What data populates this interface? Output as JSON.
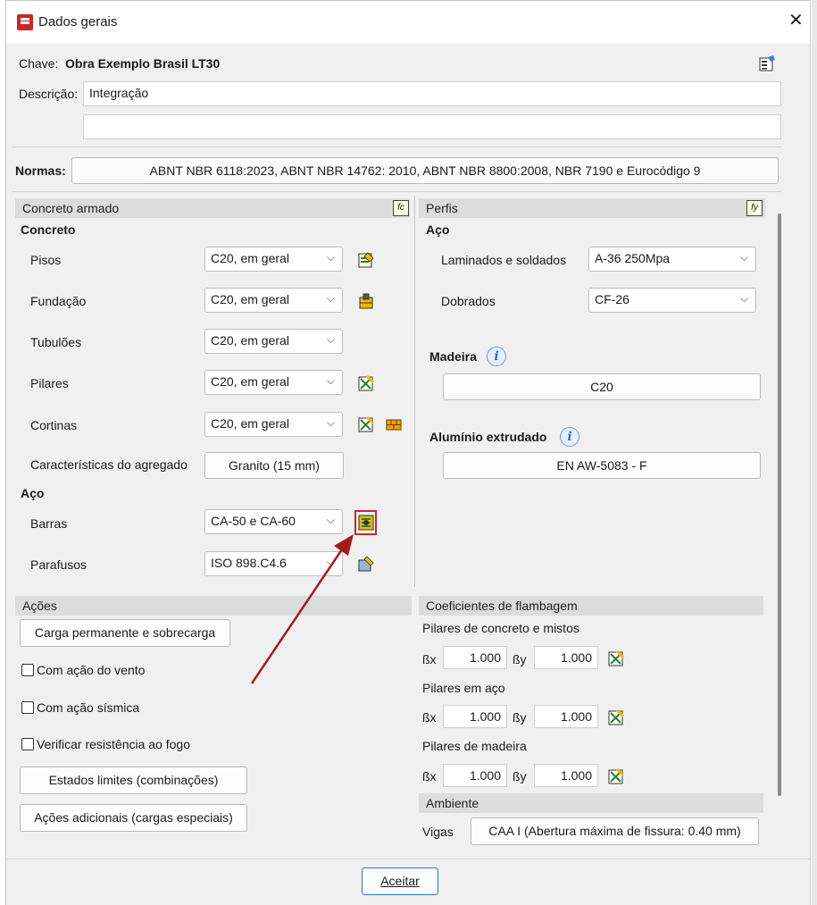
{
  "window": {
    "title": "Dados gerais",
    "help_icon": "?",
    "close_icon": "✕"
  },
  "header": {
    "chave_label": "Chave:",
    "chave_value": "Obra Exemplo Brasil LT30",
    "descricao_label": "Descrição:",
    "descricao_value": "Integração",
    "descricao_value2": "",
    "normas_label": "Normas:",
    "normas_value": "ABNT NBR 6118:2023, ABNT NBR 14762: 2010, ABNT NBR 8800:2008, NBR 7190 e Eurocódigo 9"
  },
  "concreto_armado": {
    "header": "Concreto armado",
    "badge": "fc",
    "concreto_title": "Concreto",
    "rows": [
      {
        "label": "Pisos",
        "value": "C20, em geral"
      },
      {
        "label": "Fundação",
        "value": "C20, em geral"
      },
      {
        "label": "Tubulões",
        "value": "C20, em geral"
      },
      {
        "label": "Pilares",
        "value": "C20, em geral"
      },
      {
        "label": "Cortinas",
        "value": "C20, em geral"
      }
    ],
    "agregado_label": "Características do agregado",
    "agregado_value": "Granito (15 mm)",
    "aco_title": "Aço",
    "barras_label": "Barras",
    "barras_value": "CA-50 e CA-60",
    "parafusos_label": "Parafusos",
    "parafusos_value": "ISO 898.C4.6"
  },
  "perfis": {
    "header": "Perfis",
    "badge": "fy",
    "aco_title": "Aço",
    "laminados_label": "Laminados e soldados",
    "laminados_value": "A-36 250Mpa",
    "dobrados_label": "Dobrados",
    "dobrados_value": "CF-26",
    "madeira_title": "Madeira",
    "madeira_value": "C20",
    "aluminio_title": "Alumínio extrudado",
    "aluminio_value": "EN AW-5083 - F"
  },
  "acoes": {
    "header": "Ações",
    "carga_button": "Carga permanente e sobrecarga",
    "vento_label": "Com ação do vento",
    "sismica_label": "Com ação sísmica",
    "fogo_label": "Verificar resistência ao fogo",
    "estados_button": "Estados limites (combinações)",
    "adicionais_button": "Ações adicionais (cargas especiais)"
  },
  "flambagem": {
    "header": "Coeficientes de flambagem",
    "groups": [
      {
        "title": "Pilares de concreto e mistos",
        "bx_label": "ßx",
        "bx": "1.000",
        "by_label": "ßy",
        "by": "1.000"
      },
      {
        "title": "Pilares em aço",
        "bx_label": "ßx",
        "bx": "1.000",
        "by_label": "ßy",
        "by": "1.000"
      },
      {
        "title": "Pilares de madeira",
        "bx_label": "ßx",
        "bx": "1.000",
        "by_label": "ßy",
        "by": "1.000"
      }
    ]
  },
  "ambiente": {
    "header": "Ambiente",
    "vigas_label": "Vigas",
    "vigas_value": "CAA I (Abertura máxima de fissura: 0.40 mm)"
  },
  "footer": {
    "aceitar_label": "Aceitar"
  },
  "colors": {
    "highlight": "#c62828",
    "arrow": "#a31c1c",
    "accent": "#2f6fd1"
  }
}
